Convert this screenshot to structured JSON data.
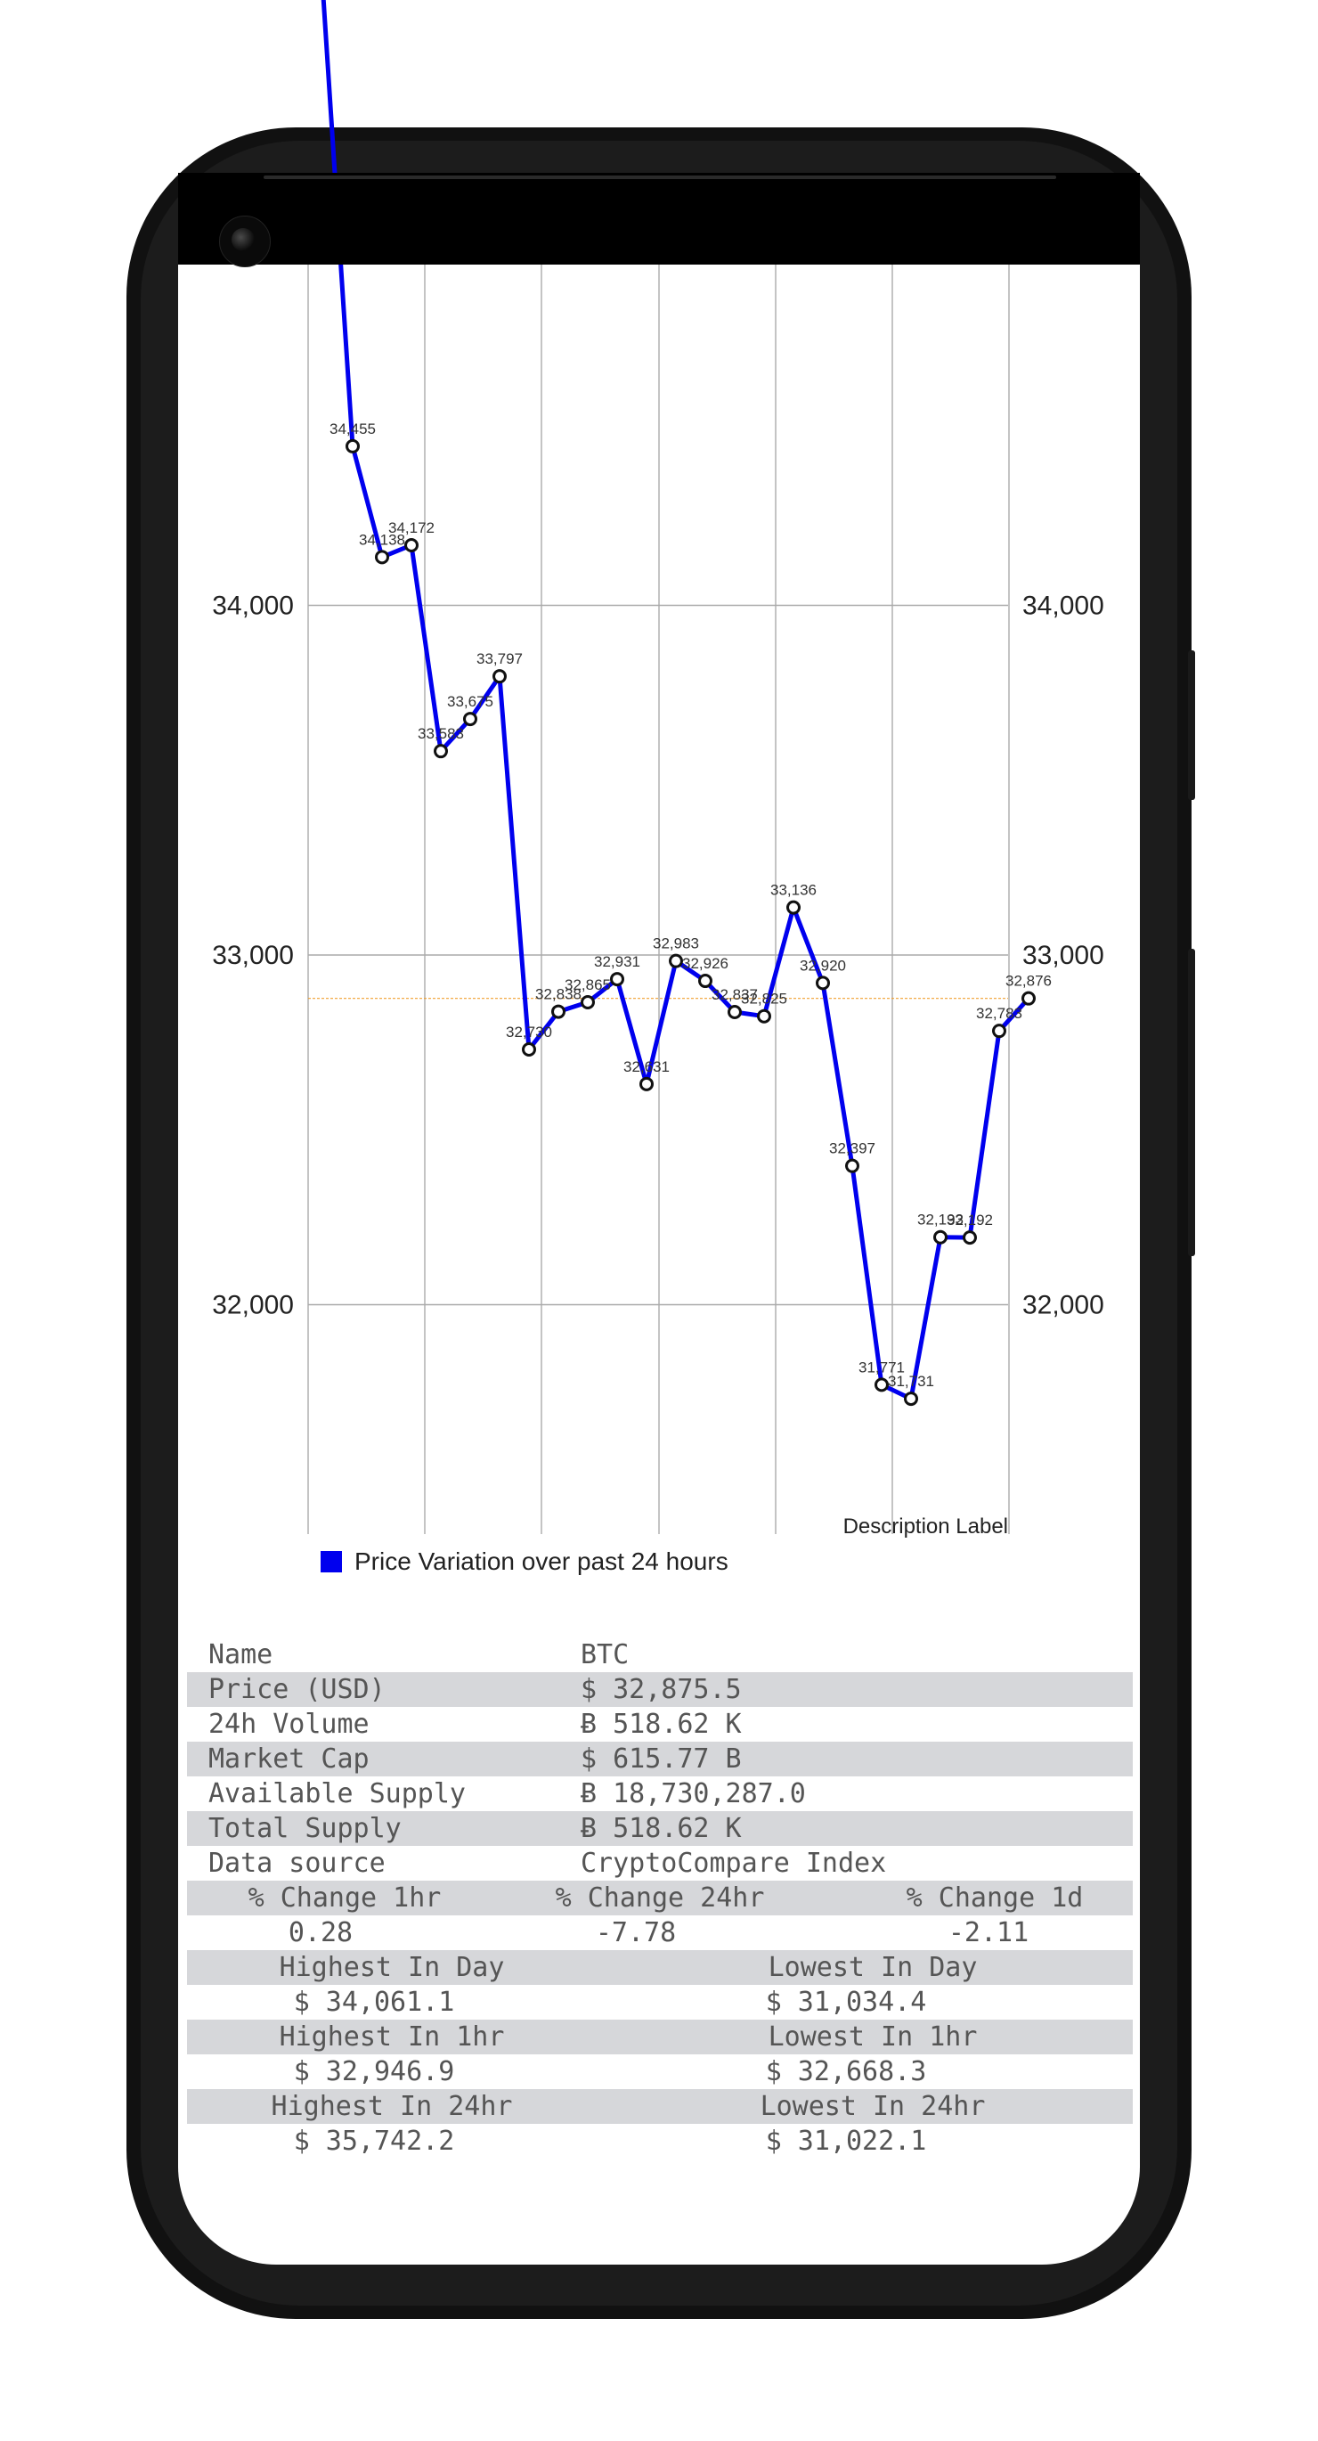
{
  "chart_data": {
    "type": "line",
    "series": [
      {
        "name": "Price Variation over past 24 hours",
        "color": "#0000ee",
        "values": [
          35742,
          34455,
          34138,
          34172,
          33583,
          33675,
          33797,
          32730,
          32838,
          32865,
          32931,
          32631,
          32983,
          32926,
          32837,
          32825,
          33136,
          32920,
          32397,
          31771,
          31731,
          32193,
          32192,
          32783,
          32876
        ]
      }
    ],
    "point_labels": [
      "",
      "34,455",
      "34,138",
      "34,172",
      "33,583",
      "33,675",
      "33,797",
      "32,730",
      "32,838",
      "32,865",
      "32,931",
      "32,631",
      "32,983",
      "32,926",
      "32,837",
      "32,825",
      "33,136",
      "32,920",
      "32,397",
      "31,771",
      "31,731",
      "32,193",
      "32,192",
      "32,783",
      "32,876"
    ],
    "y_ticks": [
      "34,000",
      "33,000",
      "32,000"
    ],
    "limit_line": 32876,
    "grid": true,
    "description": "Description Label"
  },
  "info": {
    "rows": [
      {
        "label": "Name",
        "value": "BTC"
      },
      {
        "label": "Price (USD)",
        "value": "$ 32,875.5"
      },
      {
        "label": "24h Volume",
        "value": "Ƀ 518.62 K"
      },
      {
        "label": "Market Cap",
        "value": "$ 615.77 B"
      },
      {
        "label": "Available Supply",
        "value": "Ƀ 18,730,287.0"
      },
      {
        "label": "Total Supply",
        "value": "Ƀ 518.62 K"
      },
      {
        "label": "Data source",
        "value": "CryptoCompare Index"
      }
    ],
    "change": {
      "headers": [
        "% Change 1hr",
        "% Change 24hr",
        "% Change 1d"
      ],
      "values": [
        "0.28",
        "-7.78",
        "-2.11"
      ]
    },
    "ranges": [
      {
        "high_label": "Highest In Day",
        "high_value": "$ 34,061.1",
        "low_label": "Lowest In Day",
        "low_value": "$ 31,034.4"
      },
      {
        "high_label": "Highest In 1hr",
        "high_value": "$ 32,946.9",
        "low_label": "Lowest In 1hr",
        "low_value": "$ 32,668.3"
      },
      {
        "high_label": "Highest In 24hr",
        "high_value": "$ 35,742.2",
        "low_label": "Lowest In 24hr",
        "low_value": "$ 31,022.1"
      }
    ]
  }
}
